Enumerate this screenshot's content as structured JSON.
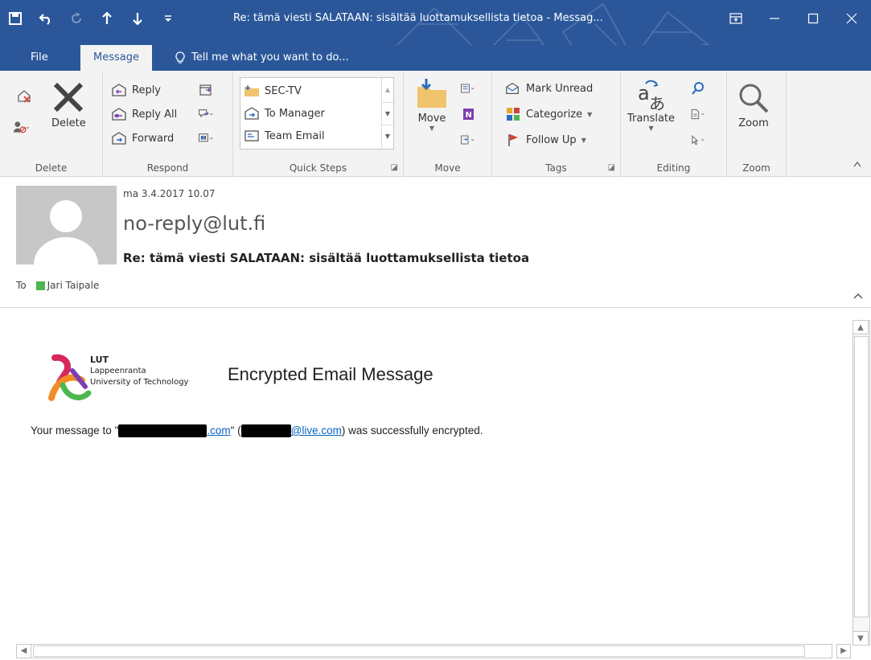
{
  "window": {
    "title": "Re: tämä viesti SALATAAN:  sisältää luottamuksellista tietoa - Messag...",
    "accent": "#2b579a"
  },
  "tabs": {
    "file": "File",
    "message": "Message",
    "tellme": "Tell me what you want to do..."
  },
  "ribbon": {
    "delete": {
      "label": "Delete",
      "group": "Delete"
    },
    "respond": {
      "reply": "Reply",
      "reply_all": "Reply All",
      "forward": "Forward",
      "group": "Respond"
    },
    "quicksteps": {
      "items": [
        "SEC-TV",
        "To Manager",
        "Team Email"
      ],
      "group": "Quick Steps"
    },
    "move": {
      "label": "Move",
      "group": "Move"
    },
    "tags": {
      "mark_unread": "Mark Unread",
      "categorize": "Categorize",
      "follow_up": "Follow Up",
      "group": "Tags"
    },
    "editing": {
      "translate": "Translate",
      "group": "Editing"
    },
    "zoom": {
      "label": "Zoom",
      "group": "Zoom"
    }
  },
  "header": {
    "date": "ma 3.4.2017 10.07",
    "from": "no-reply@lut.fi",
    "subject": "Re: tämä viesti SALATAAN:  sisältää luottamuksellista tietoa",
    "to_label": "To",
    "to_name": "Jari Taipale"
  },
  "body": {
    "logo_line1": "LUT",
    "logo_line2": "Lappeenranta",
    "logo_line3": "University of Technology",
    "title": "Encrypted Email Message",
    "msg_prefix": "Your message to \"",
    "link1": ".com",
    "msg_mid": "\" (",
    "link2": "@live.com",
    "msg_suffix": ") was successfully encrypted."
  }
}
